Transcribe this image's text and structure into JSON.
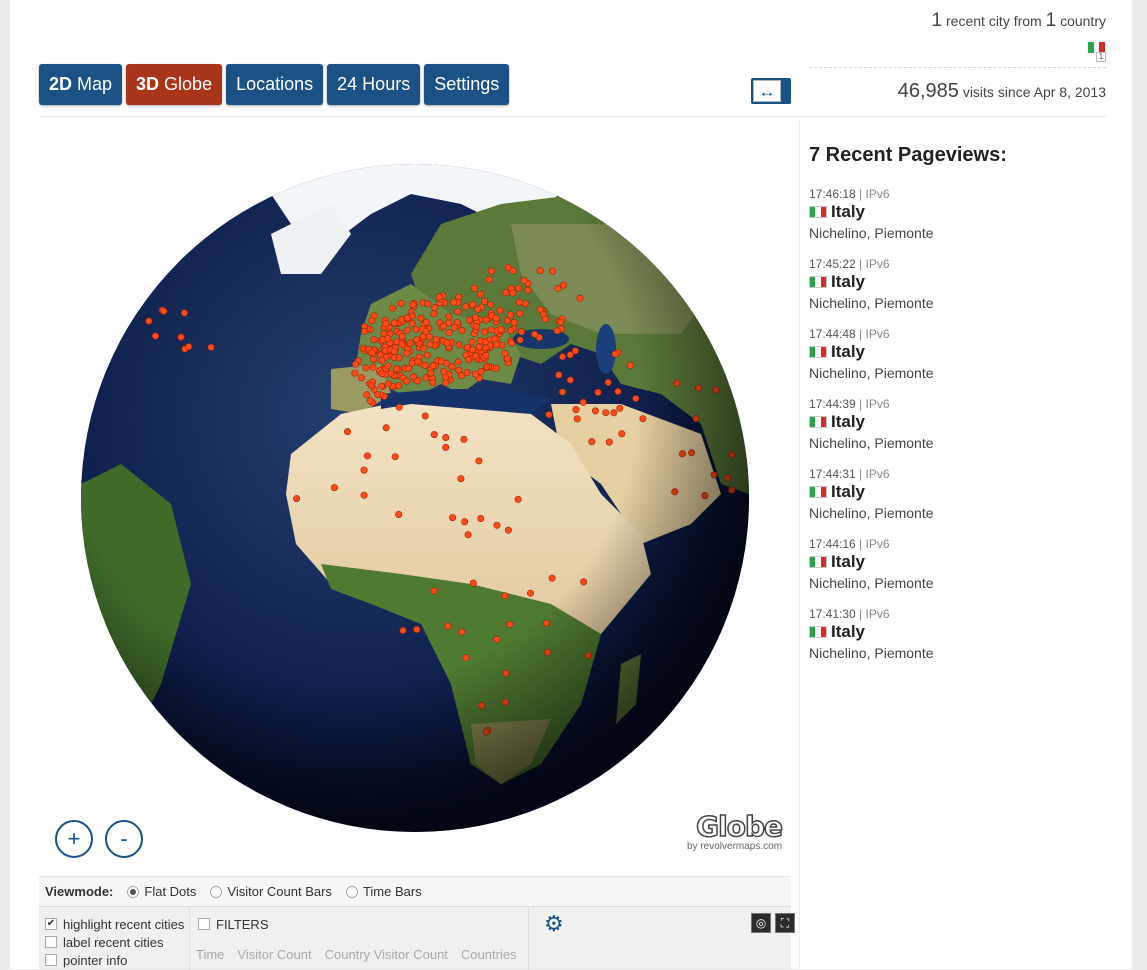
{
  "tabs": [
    {
      "bold": "2D",
      "label": "Map"
    },
    {
      "bold": "3D",
      "label": "Globe"
    },
    {
      "bold": "",
      "label": "Locations"
    },
    {
      "bold": "",
      "label": "24 Hours"
    },
    {
      "bold": "",
      "label": "Settings"
    }
  ],
  "expand_glyph": "↔",
  "summary": {
    "city_count": "1",
    "city_text": "recent city from",
    "country_count": "1",
    "country_text": "country",
    "flag_count": "1"
  },
  "visits": {
    "count": "46,985",
    "text": "visits since Apr 8, 2013"
  },
  "recent": {
    "title": "7 Recent Pageviews:",
    "items": [
      {
        "time": "17:46:18",
        "ip": "IPv6",
        "country": "Italy",
        "city": "Nichelino, Piemonte"
      },
      {
        "time": "17:45:22",
        "ip": "IPv6",
        "country": "Italy",
        "city": "Nichelino, Piemonte"
      },
      {
        "time": "17:44:48",
        "ip": "IPv6",
        "country": "Italy",
        "city": "Nichelino, Piemonte"
      },
      {
        "time": "17:44:39",
        "ip": "IPv6",
        "country": "Italy",
        "city": "Nichelino, Piemonte"
      },
      {
        "time": "17:44:31",
        "ip": "IPv6",
        "country": "Italy",
        "city": "Nichelino, Piemonte"
      },
      {
        "time": "17:44:16",
        "ip": "IPv6",
        "country": "Italy",
        "city": "Nichelino, Piemonte"
      },
      {
        "time": "17:41:30",
        "ip": "IPv6",
        "country": "Italy",
        "city": "Nichelino, Piemonte"
      }
    ]
  },
  "zoom": {
    "in": "+",
    "out": "-"
  },
  "brand": {
    "logo": "Globe",
    "by": "by revolvermaps.com"
  },
  "viewmode": {
    "label": "Viewmode:",
    "options": [
      "Flat Dots",
      "Visitor Count Bars",
      "Time Bars"
    ],
    "selected": "Flat Dots"
  },
  "options": {
    "highlight": "highlight recent cities",
    "label_cities": "label recent cities",
    "pointer": "pointer info"
  },
  "filters": {
    "label": "FILTERS",
    "columns": [
      "Time",
      "Visitor Count",
      "Country Visitor Count",
      "Countries"
    ]
  },
  "colors": {
    "primary": "#1b5185",
    "active": "#a8341a",
    "dot": "#ff4a1c",
    "ocean": "#0a1a45"
  },
  "flag_colors": [
    "#2aa64a",
    "#ffffff",
    "#d32b2b"
  ]
}
